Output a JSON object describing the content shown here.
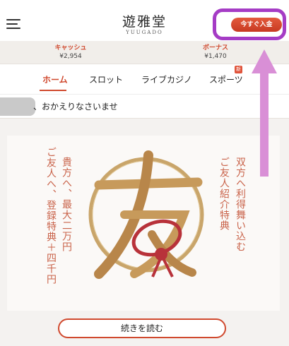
{
  "header": {
    "logo_jp": "遊雅堂",
    "logo_en": "YUUGADO",
    "deposit_label": "今すぐ入金"
  },
  "balances": {
    "cash_label": "キャッシュ",
    "cash_value": "¥2,954",
    "bonus_label": "ボーナス",
    "bonus_value": "¥1,470"
  },
  "nav": {
    "tabs": [
      {
        "label": "ホーム",
        "active": true
      },
      {
        "label": "スロット"
      },
      {
        "label": "ライブカジノ"
      },
      {
        "label": "スポーツ",
        "badge": "新"
      }
    ]
  },
  "welcome": {
    "text": "、おかえりなさいませ"
  },
  "banner": {
    "emblem": "友",
    "right_col1": "双方へ利得舞い込む",
    "right_col2": "ご友人紹介特典",
    "left_col1": "貴方へ、最大二万円",
    "left_col2": "ご友人へ、登録特典＋四千円"
  },
  "cta": {
    "read_more": "続きを読む"
  },
  "colors": {
    "accent": "#d0492e",
    "highlight": "#a53cc5",
    "arrow": "#d98fd6"
  }
}
